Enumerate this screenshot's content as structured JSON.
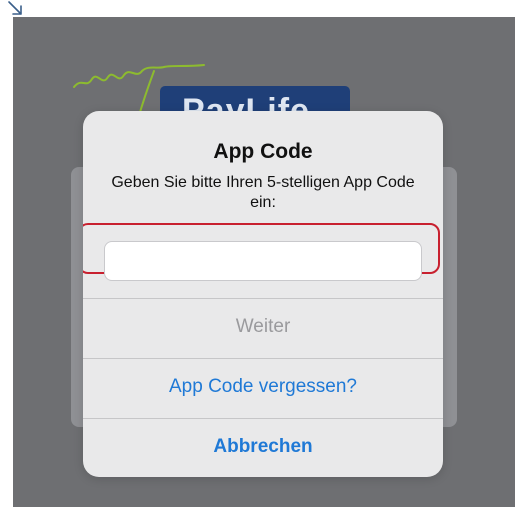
{
  "background": {
    "logo_text": "PayLife",
    "colors": {
      "overlay": "#6e6f72",
      "logo_box": "#1f3f78",
      "script_green": "#8dbb2f",
      "arrow": "#3a5f8a"
    }
  },
  "alert": {
    "title": "App Code",
    "message": "Geben Sie bitte Ihren 5-stelligen App Code ein:",
    "input": {
      "value": "",
      "placeholder": ""
    },
    "buttons": {
      "continue_label": "Weiter",
      "forgot_label": "App Code vergessen?",
      "cancel_label": "Abbrechen"
    },
    "colors": {
      "highlight_border": "#c8202f",
      "action_blue": "#1f79d6",
      "disabled_gray": "#9a9a9d"
    }
  }
}
